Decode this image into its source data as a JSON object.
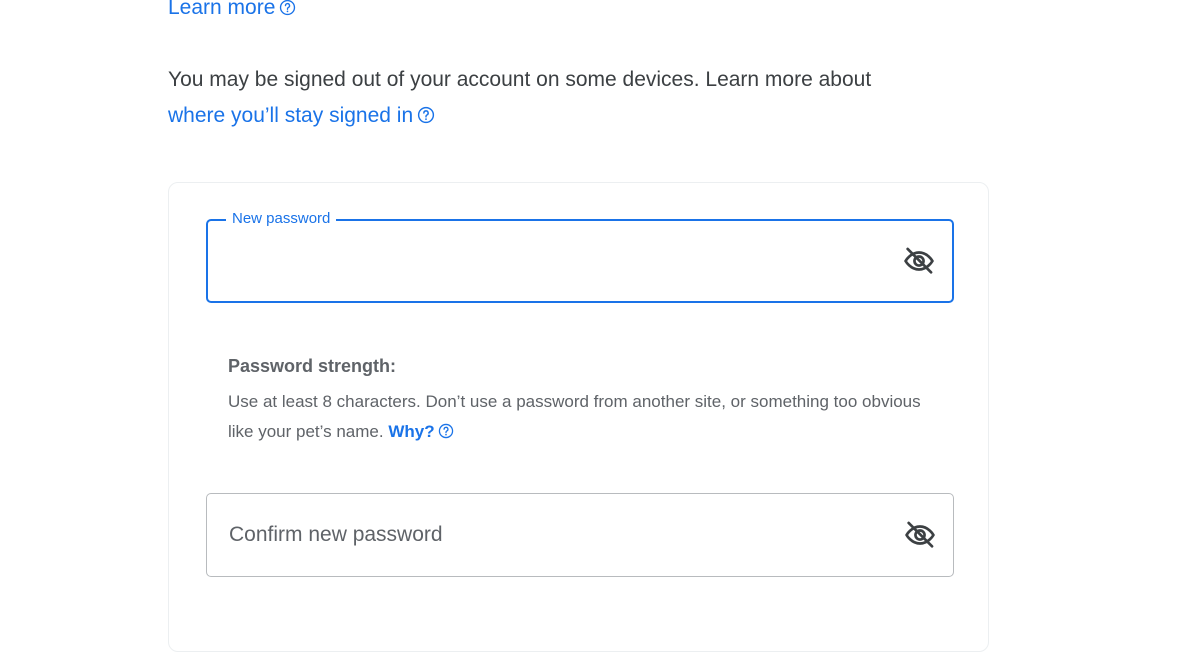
{
  "learn_more": {
    "label": "Learn more",
    "icon": "help-circle-icon"
  },
  "notice": {
    "text": "You may be signed out of your account on some devices. Learn more about",
    "link_label": "where you’ll stay signed in",
    "link_icon": "help-circle-icon"
  },
  "new_password": {
    "label": "New password",
    "value": "",
    "toggle_icon": "eye-off-icon"
  },
  "strength": {
    "heading": "Password strength:",
    "hint": "Use at least 8 characters. Don’t use a password from another site, or something too obvious like your pet’s name.",
    "why_label": "Why?",
    "why_icon": "help-circle-icon"
  },
  "confirm_password": {
    "placeholder": "Confirm new password",
    "value": "",
    "toggle_icon": "eye-off-icon"
  },
  "colors": {
    "link": "#1a73e8",
    "focus_border": "#1a73e8",
    "text": "#3c4043",
    "secondary_text": "#5f6368",
    "field_border": "#b8bbbe"
  }
}
